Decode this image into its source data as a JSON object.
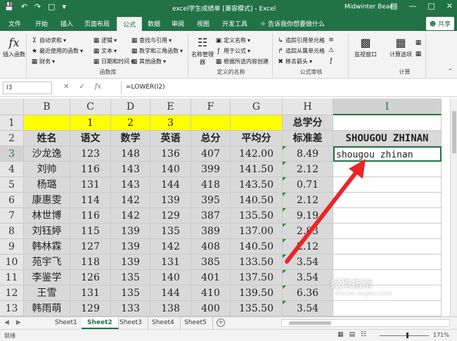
{
  "titlebar": {
    "title": "excel学生成绩单  [兼容模式] - Excel",
    "user": "Midwinter Bear",
    "save_icon": "save-icon",
    "undo_icon": "undo-icon",
    "redo_icon": "redo-icon"
  },
  "tabs": [
    "文件",
    "开始",
    "插入",
    "页面布局",
    "公式",
    "数据",
    "审阅",
    "视图",
    "开发工具"
  ],
  "active_tab": "公式",
  "tell_me": "告诉我你想要做什么",
  "share": "共享",
  "ribbon": {
    "insert_function": "插入函数",
    "autosum": "自动求和",
    "recent": "最近使用的函数",
    "financial": "财务",
    "logical": "逻辑",
    "text": "文本",
    "datetime": "日期和时间",
    "lookup": "查找与引用",
    "mathtrig": "数学和三角函数",
    "more": "其他函数",
    "library_label": "函数库",
    "name_manager": "名称管理器",
    "define_name": "定义名称",
    "use_in_formula": "用于公式",
    "create_from_sel": "根据所选内容创建",
    "defined_names_label": "定义的名称",
    "trace_precedents": "追踪引用单元格",
    "trace_dependents": "追踪从属单元格",
    "remove_arrows": "移去箭头",
    "audit_label": "公式审核",
    "watch": "监视窗口",
    "calc_options": "计算选项",
    "calc_label": "计算"
  },
  "formula_bar": {
    "name_box": "I3",
    "formula": "=LOWER(I2)"
  },
  "columns": [
    "B",
    "C",
    "D",
    "E",
    "F",
    "G",
    "H",
    "I"
  ],
  "selected_column": "I",
  "rows": [
    "1",
    "2",
    "3",
    "4",
    "5",
    "6",
    "7",
    "8",
    "9",
    "10",
    "11",
    "12",
    "13"
  ],
  "selected_row": "3",
  "row1": {
    "C": "1",
    "D": "2",
    "E": "3",
    "H": "总学分"
  },
  "headers": [
    "姓名",
    "语文",
    "数学",
    "英语",
    "总分",
    "平均分",
    "标准差"
  ],
  "I2": "SHOUGOU ZHINAN",
  "I3": "shougou zhinan",
  "data": [
    [
      "沙龙逸",
      "123",
      "148",
      "136",
      "407",
      "142.00",
      "8.49"
    ],
    [
      "刘帅",
      "116",
      "143",
      "140",
      "399",
      "141.50",
      "2.12"
    ],
    [
      "杨璐",
      "131",
      "143",
      "144",
      "418",
      "143.50",
      "0.71"
    ],
    [
      "康惠雯",
      "114",
      "142",
      "139",
      "395",
      "140.50",
      "2.12"
    ],
    [
      "林世博",
      "116",
      "142",
      "129",
      "387",
      "135.50",
      "9.19"
    ],
    [
      "刘钰婷",
      "115",
      "139",
      "135",
      "389",
      "137.00",
      "2.83"
    ],
    [
      "韩林霖",
      "127",
      "139",
      "142",
      "408",
      "140.50",
      "2.12"
    ],
    [
      "苑宇飞",
      "118",
      "139",
      "131",
      "385",
      "133.50",
      "3.54"
    ],
    [
      "李鉴学",
      "126",
      "135",
      "140",
      "401",
      "137.50",
      "3.54"
    ],
    [
      "王雪",
      "131",
      "135",
      "144",
      "410",
      "139.50",
      "6.36"
    ],
    [
      "韩雨萌",
      "129",
      "133",
      "138",
      "400",
      "135.50",
      "3.54"
    ]
  ],
  "sheets": [
    "Sheet1",
    "Sheet2",
    "Sheet3",
    "Sheet4",
    "Sheet5"
  ],
  "active_sheet": "Sheet2",
  "status": {
    "ready": "就绪",
    "zoom": "171%"
  },
  "watermark": {
    "text": "搜狗指南",
    "url": "zhinan.sogou.com"
  },
  "colors": {
    "excel_green": "#217346",
    "yellow": "#ffff00",
    "gray_fill": "#d9d9d9",
    "arrow": "#e8262a"
  }
}
